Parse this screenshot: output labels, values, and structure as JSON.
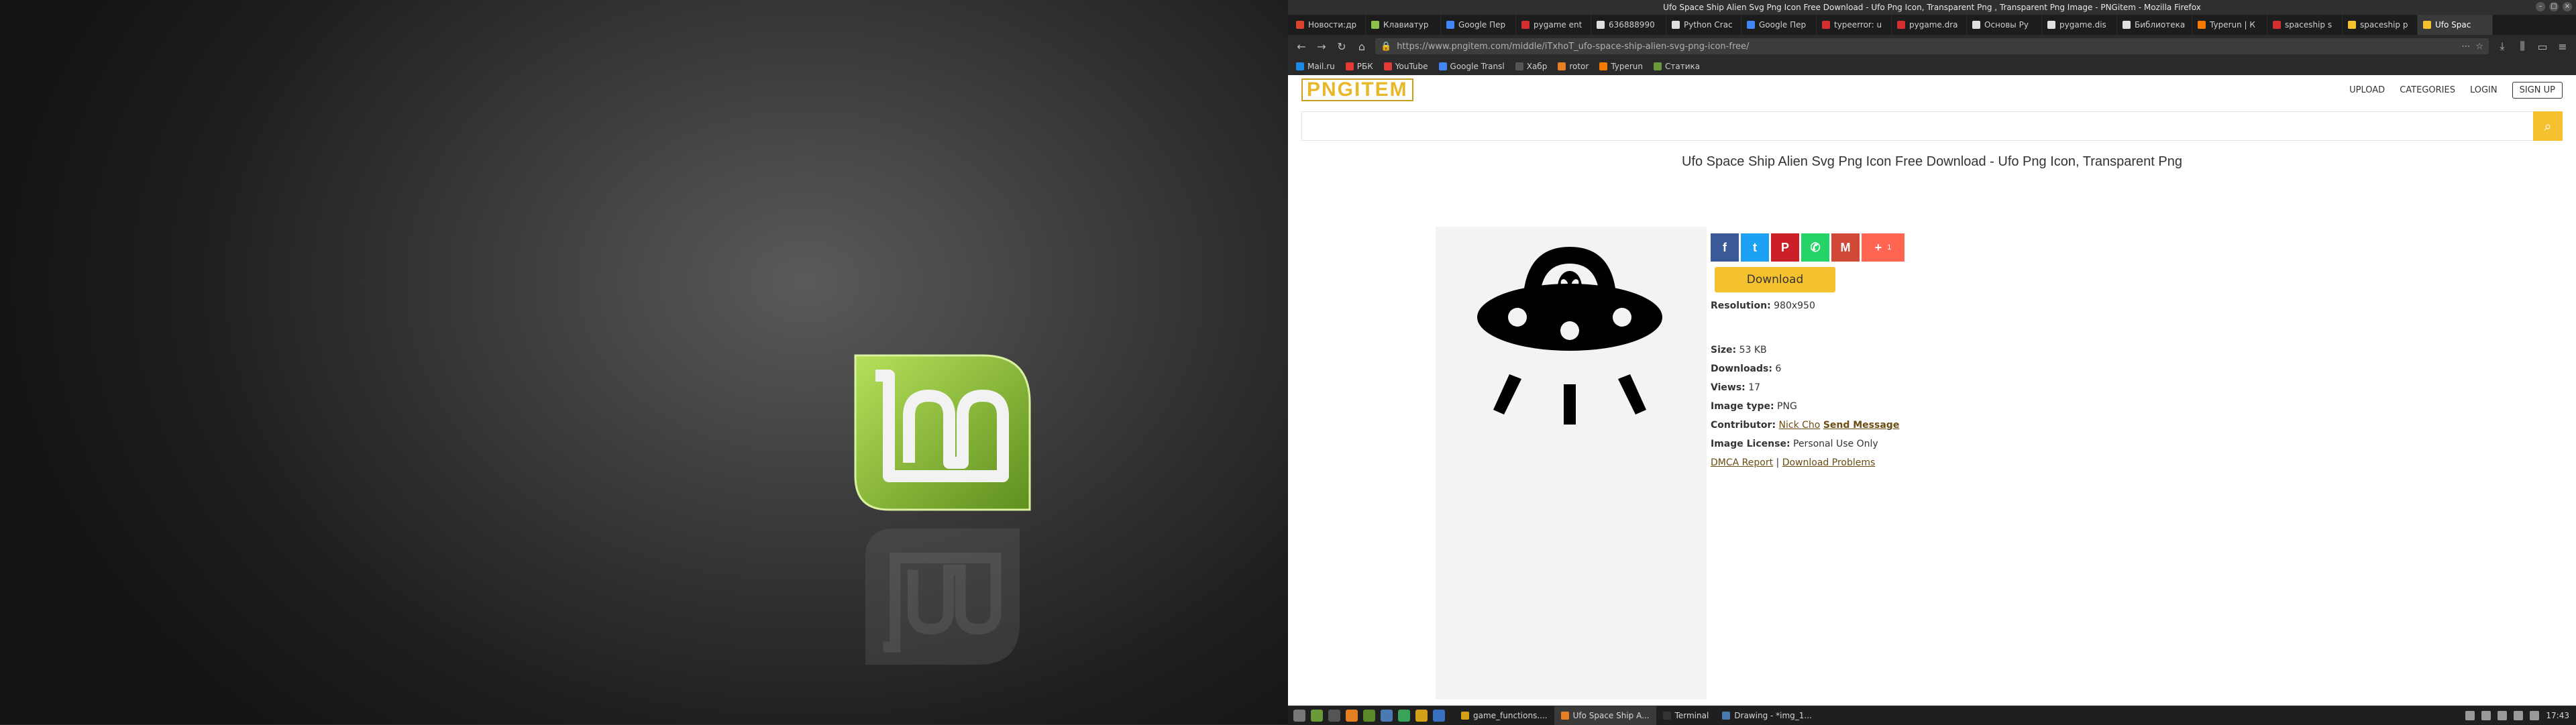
{
  "window": {
    "title": "Ufo Space Ship Alien Svg Png Icon Free Download - Ufo Png Icon, Transparent Png , Transparent Png Image - PNGitem - Mozilla Firefox"
  },
  "tabs": [
    {
      "label": "Новости:др",
      "color": "#d8442f"
    },
    {
      "label": "Клавиатур",
      "color": "#8bc34a"
    },
    {
      "label": "Google Пер",
      "color": "#4285f4"
    },
    {
      "label": "pygame ent",
      "color": "#d32f2f"
    },
    {
      "label": "636888990",
      "color": "#e0e0e0"
    },
    {
      "label": "Python Crac",
      "color": "#e0e0e0"
    },
    {
      "label": "Google Пер",
      "color": "#4285f4"
    },
    {
      "label": "typeerror: u",
      "color": "#d32f2f"
    },
    {
      "label": "pygame.dra",
      "color": "#d32f2f"
    },
    {
      "label": "Основы Py",
      "color": "#e0e0e0"
    },
    {
      "label": "pygame.dis",
      "color": "#e0e0e0"
    },
    {
      "label": "Библиотека Py",
      "color": "#e0e0e0"
    },
    {
      "label": "Typerun | К",
      "color": "#f57c00"
    },
    {
      "label": "spaceship s",
      "color": "#d32f2f"
    },
    {
      "label": "spaceship p",
      "color": "#f6c12f"
    },
    {
      "label": "Ufo Spac",
      "color": "#f6c12f",
      "active": true
    }
  ],
  "url": "https://www.pngitem.com/middle/iTxhoT_ufo-space-ship-alien-svg-png-icon-free/",
  "bookmarks": [
    "Mail.ru",
    "РБК",
    "YouTube",
    "Google Transl",
    "Хабр",
    "rotor",
    "Typerun",
    "Статика"
  ],
  "site": {
    "logo": "PNGITEM",
    "nav": [
      "UPLOAD",
      "CATEGORIES",
      "LOGIN"
    ],
    "signup": "SIGN UP",
    "title": "Ufo Space Ship Alien Svg Png Icon Free Download - Ufo Png Icon, Transparent Png"
  },
  "share": {
    "plus_count": "1"
  },
  "download": "Download",
  "info": {
    "resolution_label": "Resolution:",
    "resolution": "980x950",
    "size_label": "Size:",
    "size": "53 KB",
    "downloads_label": "Downloads:",
    "downloads": "6",
    "views_label": "Views:",
    "views": "17",
    "type_label": "Image type:",
    "type": "PNG",
    "contributor_label": "Contributor:",
    "contributor": "Nick Cho",
    "send_message": "Send Message",
    "license_label": "Image License:",
    "license": "Personal Use Only",
    "dmca": "DMCA Report",
    "sep": "|",
    "problems": "Download Problems"
  },
  "taskbar": {
    "tasks": [
      "game_functions....",
      "Ufo Space Ship A...",
      "Terminal",
      "Drawing - *img_1..."
    ],
    "time": "17:43"
  }
}
